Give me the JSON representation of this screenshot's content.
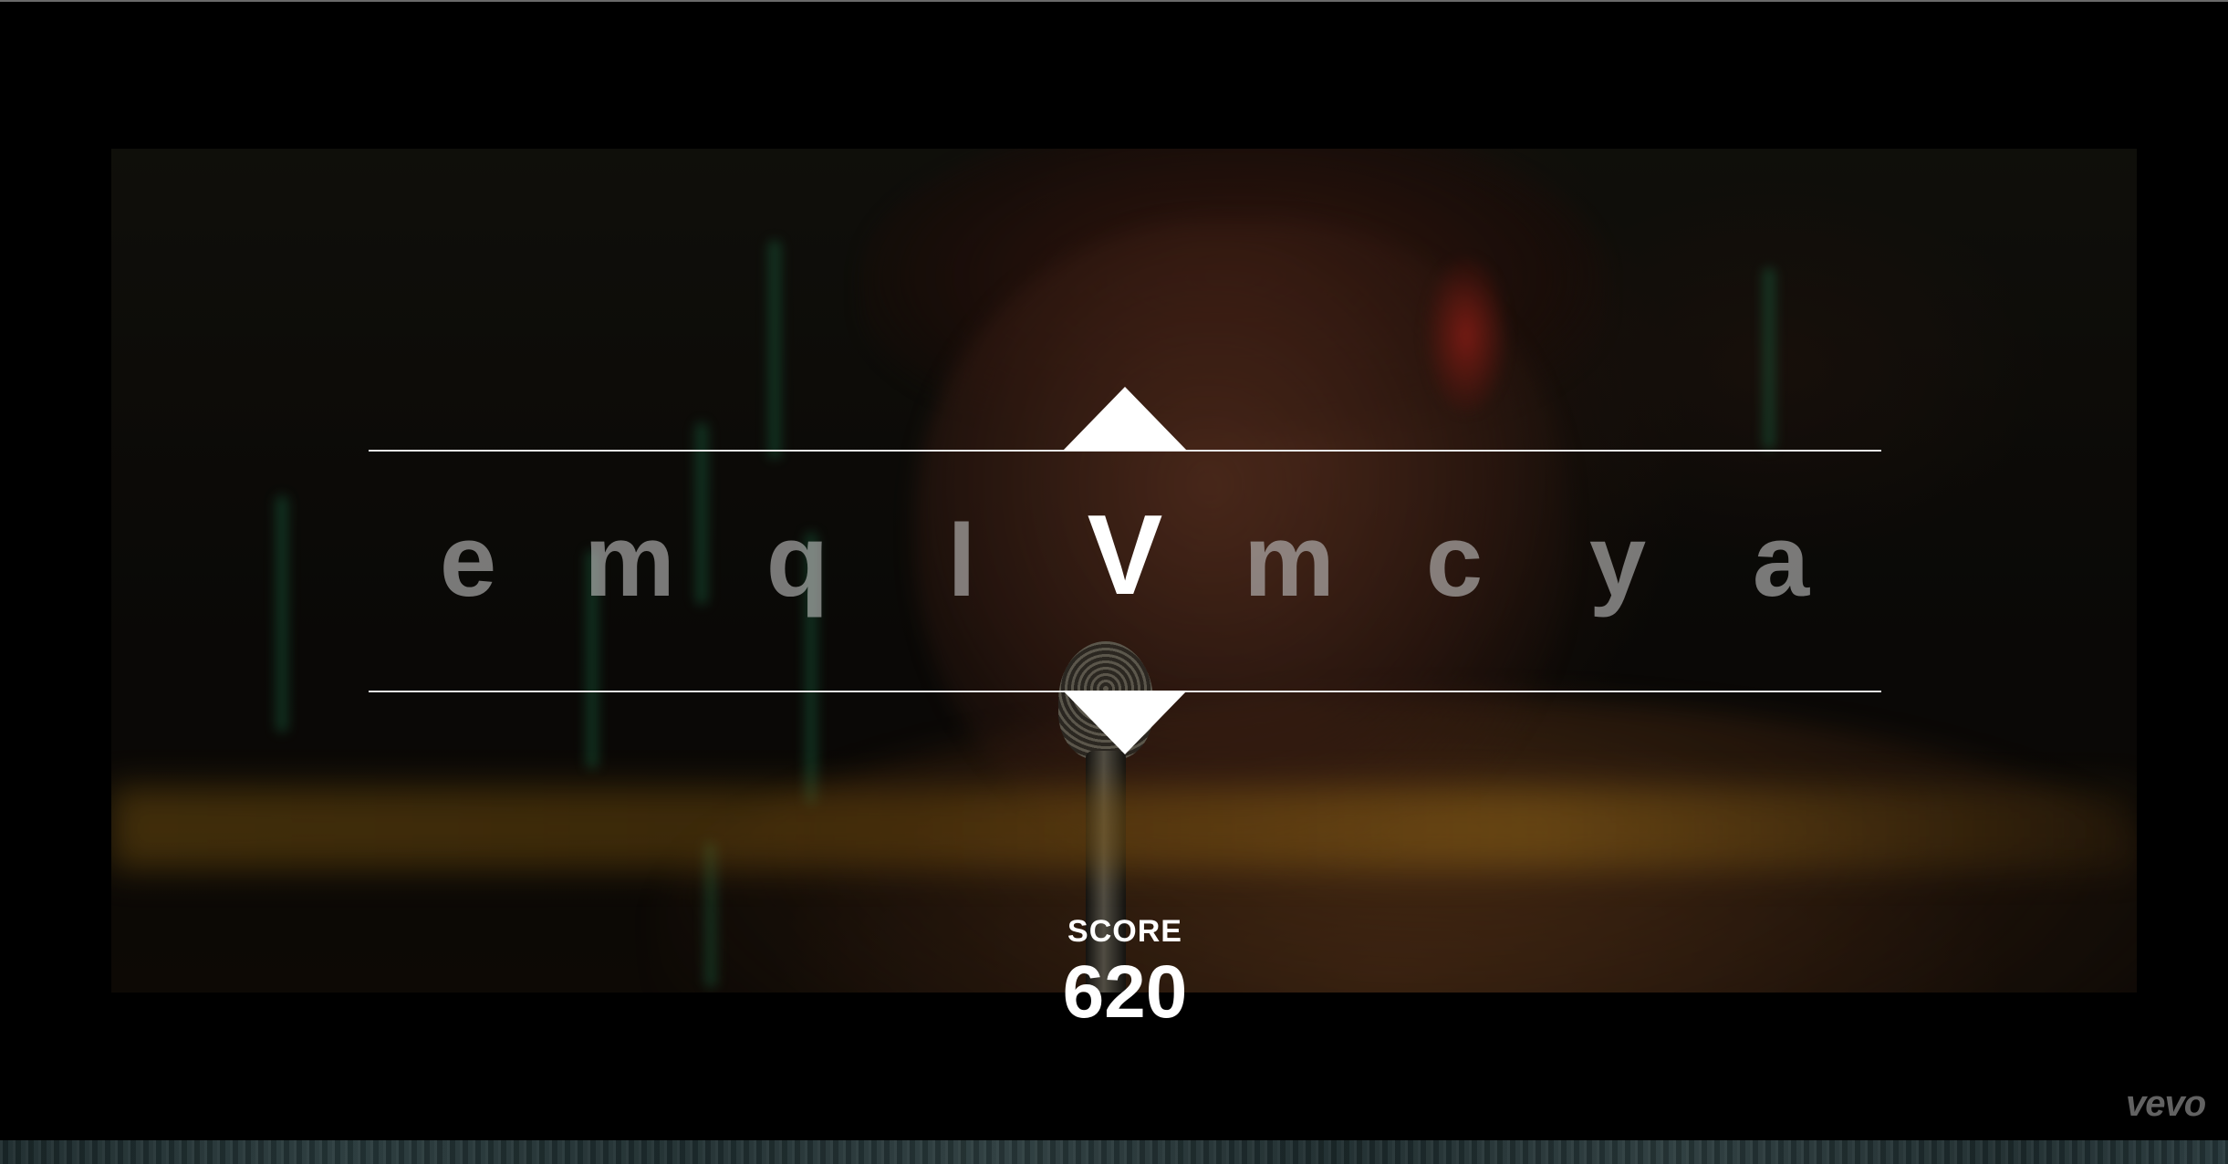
{
  "game": {
    "letters": [
      "e",
      "m",
      "q",
      "l",
      "V",
      "m",
      "c",
      "y",
      "a"
    ],
    "active_index": 4
  },
  "score": {
    "label": "SCORE",
    "value": "620"
  },
  "watermark": {
    "text": "vevo"
  },
  "colors": {
    "background": "#000000",
    "selector_lines": "#e6e6e6",
    "active_letter": "#ffffff",
    "inactive_letter": "#bebebe"
  }
}
